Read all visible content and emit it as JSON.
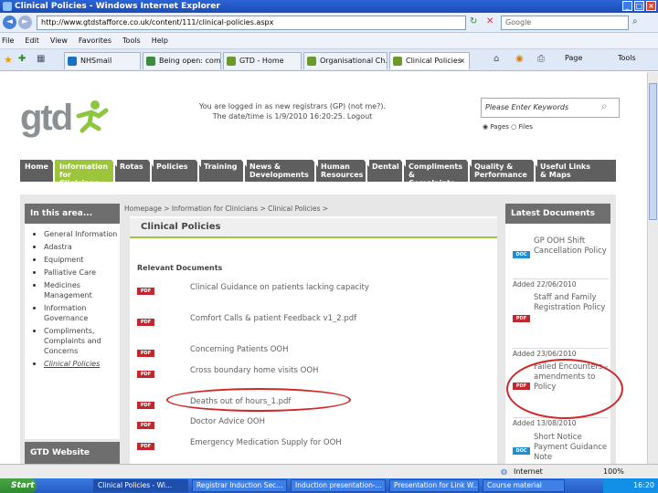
{
  "window": {
    "title": "Clinical Policies - Windows Internet Explorer"
  },
  "address": {
    "url": "http://www.gtdstafforce.co.uk/content/111/clinical-policies.aspx",
    "search_placeholder": "Google"
  },
  "menu": [
    "File",
    "Edit",
    "View",
    "Favorites",
    "Tools",
    "Help"
  ],
  "tabs": [
    {
      "label": "NHSmail"
    },
    {
      "label": "Being open: com..."
    },
    {
      "label": "GTD - Home"
    },
    {
      "label": "Organisational Ch..."
    },
    {
      "label": "Clinical Policies"
    }
  ],
  "toolbar": {
    "page": "Page",
    "tools": "Tools"
  },
  "site": {
    "logo": "gtd",
    "welcome1": "You are logged in as new registrars (GP) (not me?).",
    "welcome2": "The date/time is 1/9/2010 16:20:25. Logout",
    "search_placeholder": "Please Enter Keywords",
    "radio_pages": "Pages",
    "radio_files": "Files",
    "nav": [
      {
        "l1": "Home",
        "l2": ""
      },
      {
        "l1": "Information",
        "l2": "for Clinicians"
      },
      {
        "l1": "Rotas",
        "l2": ""
      },
      {
        "l1": "Policies",
        "l2": ""
      },
      {
        "l1": "Training",
        "l2": ""
      },
      {
        "l1": "News &",
        "l2": "Developments"
      },
      {
        "l1": "Human",
        "l2": "Resources"
      },
      {
        "l1": "Dental",
        "l2": ""
      },
      {
        "l1": "Compliments",
        "l2": "& Complaints"
      },
      {
        "l1": "Quality &",
        "l2": "Performance"
      },
      {
        "l1": "Useful Links",
        "l2": "& Maps"
      }
    ],
    "left_title": "In this area...",
    "left_items": [
      "General Information",
      "Adastra",
      "Equipment",
      "Palliative Care",
      "Medicines Management",
      "Information Governance",
      "Compliments, Complaints and Concerns",
      "Clinical Policies"
    ],
    "left_title2": "GTD Website",
    "breadcrumb": "Homepage > Information for Clinicians > Clinical Policies >",
    "page_title": "Clinical Policies",
    "relevant": "Relevant Documents",
    "docs": [
      "Clinical Guidance on patients lacking capacity",
      "Comfort Calls & patient Feedback v1_2.pdf",
      "Concerning Patients OOH",
      "Cross boundary home visits OOH",
      "Deaths out of hours_1.pdf",
      "Doctor Advice OOH",
      "Emergency Medication Supply for OOH"
    ],
    "pdf_icon": "PDF",
    "doc_icon": "DOC",
    "latest_title": "Latest Documents",
    "latest": [
      {
        "icon": "DOC",
        "title": "GP OOH Shift Cancellation Policy",
        "added": "Added 22/06/2010"
      },
      {
        "icon": "PDF",
        "title": "Staff and Family Registration Policy",
        "added": "Added 23/06/2010"
      },
      {
        "icon": "PDF",
        "title": "Failed Encounters - amendments to Policy",
        "added": "Added 13/08/2010"
      },
      {
        "icon": "DOC",
        "title": "Short Notice Payment Guidance Note",
        "added": ""
      }
    ]
  },
  "status": {
    "zone": "Internet",
    "zoom": "100%"
  },
  "taskbar": {
    "start": "Start",
    "items": [
      "Clinical Policies - Wi...",
      "Registrar Induction Sec...",
      "Induction presentation-...",
      "Presentation for Link W...",
      "Course material"
    ],
    "time": "16:20"
  },
  "colors": {
    "accent_green": "#9dc53b",
    "nav_gray": "#5f5f5f",
    "annotation_red": "#d02828"
  }
}
